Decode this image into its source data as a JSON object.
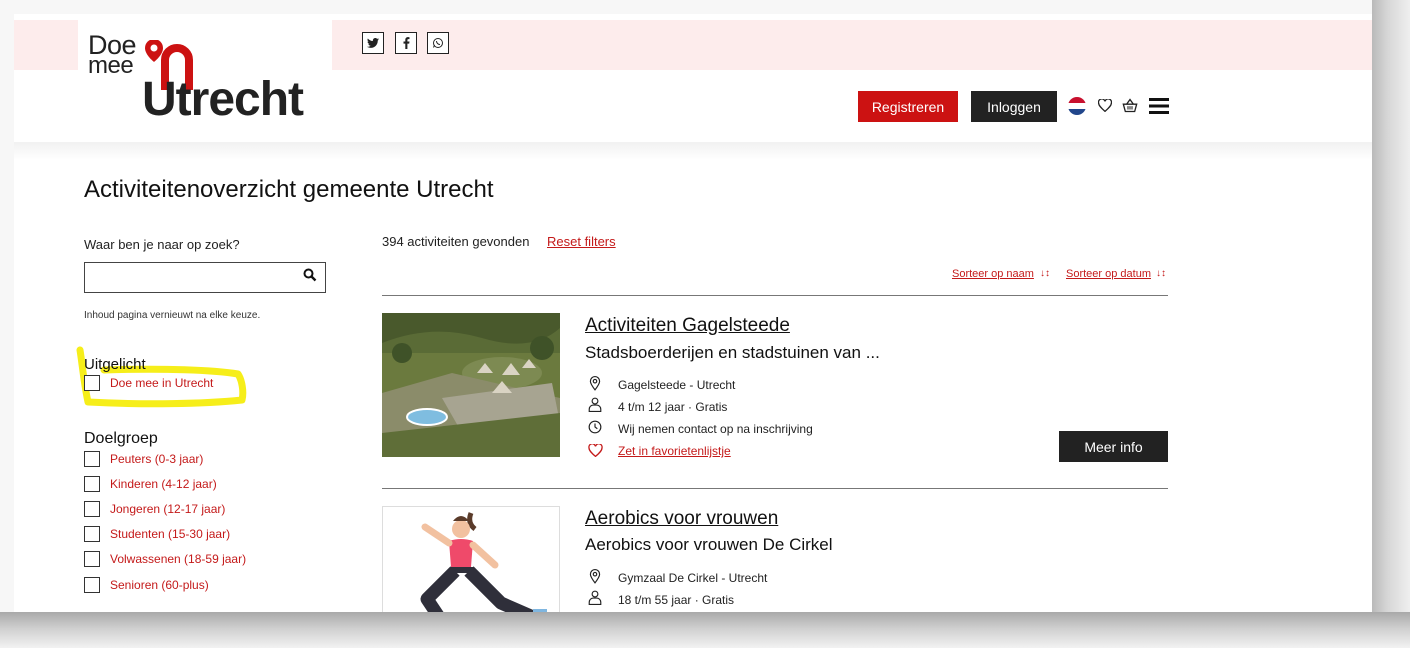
{
  "header": {
    "logo_line1": "Doe",
    "logo_line2": "mee",
    "logo_line3": "Utrecht",
    "logo_in": "in",
    "social": [
      "twitter-icon",
      "facebook-icon",
      "whatsapp-icon"
    ],
    "register_label": "Registreren",
    "login_label": "Inloggen",
    "accent_color": "#cc1212"
  },
  "page": {
    "title": "Activiteitenoverzicht gemeente Utrecht"
  },
  "filters": {
    "search_label": "Waar ben je naar op zoek?",
    "search_value": "",
    "note": "Inhoud pagina vernieuwt na elke keuze.",
    "featured_title": "Uitgelicht",
    "featured_items": [
      "Doe mee in Utrecht"
    ],
    "audience_title": "Doelgroep",
    "audience_items": [
      "Peuters (0-3 jaar)",
      "Kinderen (4-12 jaar)",
      "Jongeren (12-17 jaar)",
      "Studenten (15-30 jaar)",
      "Volwassenen (18-59 jaar)",
      "Senioren (60-plus)"
    ]
  },
  "results": {
    "count_text": "394 activiteiten gevonden",
    "reset_label": "Reset filters",
    "sort_name_label": "Sorteer op naam",
    "sort_date_label": "Sorteer op datum",
    "items": [
      {
        "title": "Activiteiten Gagelsteede",
        "subtitle": "Stadsboerderijen en stadstuinen van ...",
        "location": "Gagelsteede - Utrecht",
        "audience": "4 t/m 12 jaar · Gratis",
        "time": "Wij nemen contact op na inschrijving",
        "favorite_label": "Zet in favorietenlijstje",
        "button_label": "Meer info"
      },
      {
        "title": "Aerobics voor vrouwen",
        "subtitle": "Aerobics voor vrouwen De Cirkel",
        "location": "Gymzaal De Cirkel - Utrecht",
        "audience": "18 t/m 55 jaar · Gratis"
      }
    ]
  }
}
